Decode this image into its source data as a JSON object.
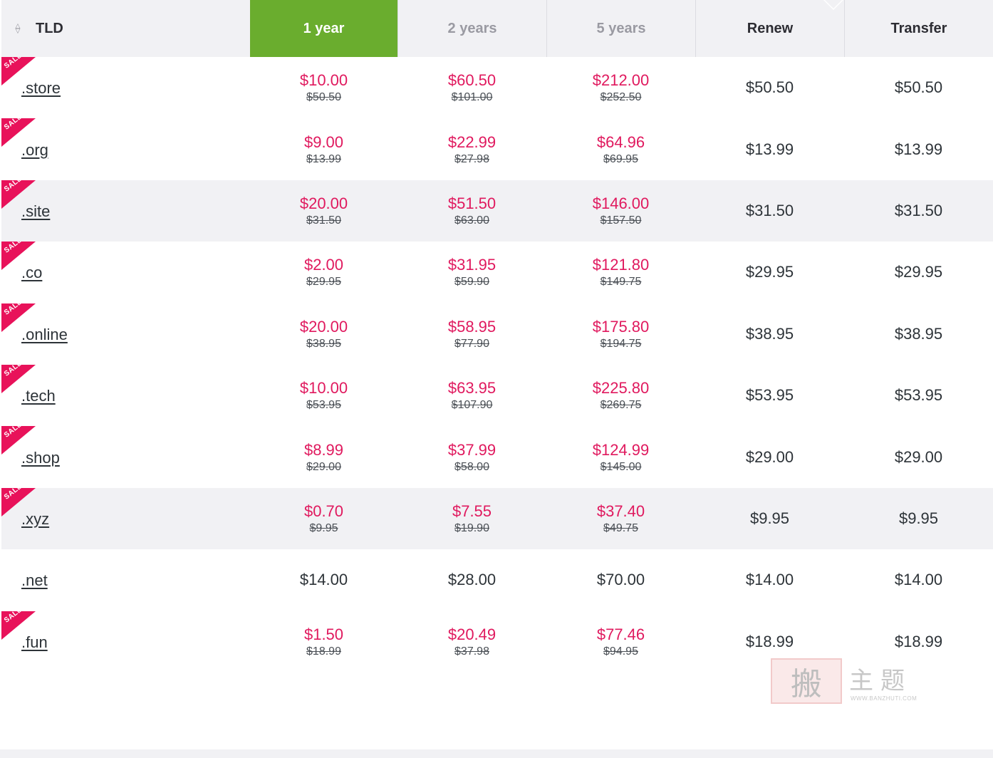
{
  "header": {
    "tld": "TLD",
    "y1": "1 year",
    "y2": "2 years",
    "y5": "5 years",
    "renew": "Renew",
    "transfer": "Transfer"
  },
  "sale_badge": "SALE",
  "colors": {
    "sale": "#e0195e",
    "active_tab": "#6aad2e",
    "badge": "#e8125a"
  },
  "rows": [
    {
      "tld": ".store",
      "sale": true,
      "y1": "$10.00",
      "y1_old": "$50.50",
      "y2": "$60.50",
      "y2_old": "$101.00",
      "y5": "$212.00",
      "y5_old": "$252.50",
      "renew": "$50.50",
      "transfer": "$50.50",
      "shade": false
    },
    {
      "tld": ".org",
      "sale": true,
      "y1": "$9.00",
      "y1_old": "$13.99",
      "y2": "$22.99",
      "y2_old": "$27.98",
      "y5": "$64.96",
      "y5_old": "$69.95",
      "renew": "$13.99",
      "transfer": "$13.99",
      "shade": false
    },
    {
      "tld": ".site",
      "sale": true,
      "y1": "$20.00",
      "y1_old": "$31.50",
      "y2": "$51.50",
      "y2_old": "$63.00",
      "y5": "$146.00",
      "y5_old": "$157.50",
      "renew": "$31.50",
      "transfer": "$31.50",
      "shade": true
    },
    {
      "tld": ".co",
      "sale": true,
      "y1": "$2.00",
      "y1_old": "$29.95",
      "y2": "$31.95",
      "y2_old": "$59.90",
      "y5": "$121.80",
      "y5_old": "$149.75",
      "renew": "$29.95",
      "transfer": "$29.95",
      "shade": false
    },
    {
      "tld": ".online",
      "sale": true,
      "y1": "$20.00",
      "y1_old": "$38.95",
      "y2": "$58.95",
      "y2_old": "$77.90",
      "y5": "$175.80",
      "y5_old": "$194.75",
      "renew": "$38.95",
      "transfer": "$38.95",
      "shade": false
    },
    {
      "tld": ".tech",
      "sale": true,
      "y1": "$10.00",
      "y1_old": "$53.95",
      "y2": "$63.95",
      "y2_old": "$107.90",
      "y5": "$225.80",
      "y5_old": "$269.75",
      "renew": "$53.95",
      "transfer": "$53.95",
      "shade": false
    },
    {
      "tld": ".shop",
      "sale": true,
      "y1": "$8.99",
      "y1_old": "$29.00",
      "y2": "$37.99",
      "y2_old": "$58.00",
      "y5": "$124.99",
      "y5_old": "$145.00",
      "renew": "$29.00",
      "transfer": "$29.00",
      "shade": false
    },
    {
      "tld": ".xyz",
      "sale": true,
      "y1": "$0.70",
      "y1_old": "$9.95",
      "y2": "$7.55",
      "y2_old": "$19.90",
      "y5": "$37.40",
      "y5_old": "$49.75",
      "renew": "$9.95",
      "transfer": "$9.95",
      "shade": true
    },
    {
      "tld": ".net",
      "sale": false,
      "y1": "$14.00",
      "y1_old": "",
      "y2": "$28.00",
      "y2_old": "",
      "y5": "$70.00",
      "y5_old": "",
      "renew": "$14.00",
      "transfer": "$14.00",
      "shade": false
    },
    {
      "tld": ".fun",
      "sale": true,
      "y1": "$1.50",
      "y1_old": "$18.99",
      "y2": "$20.49",
      "y2_old": "$37.98",
      "y5": "$77.46",
      "y5_old": "$94.95",
      "renew": "$18.99",
      "transfer": "$18.99",
      "shade": false
    }
  ],
  "watermark": {
    "chars": "主题",
    "url": "WWW.BANZHUTI.COM"
  }
}
